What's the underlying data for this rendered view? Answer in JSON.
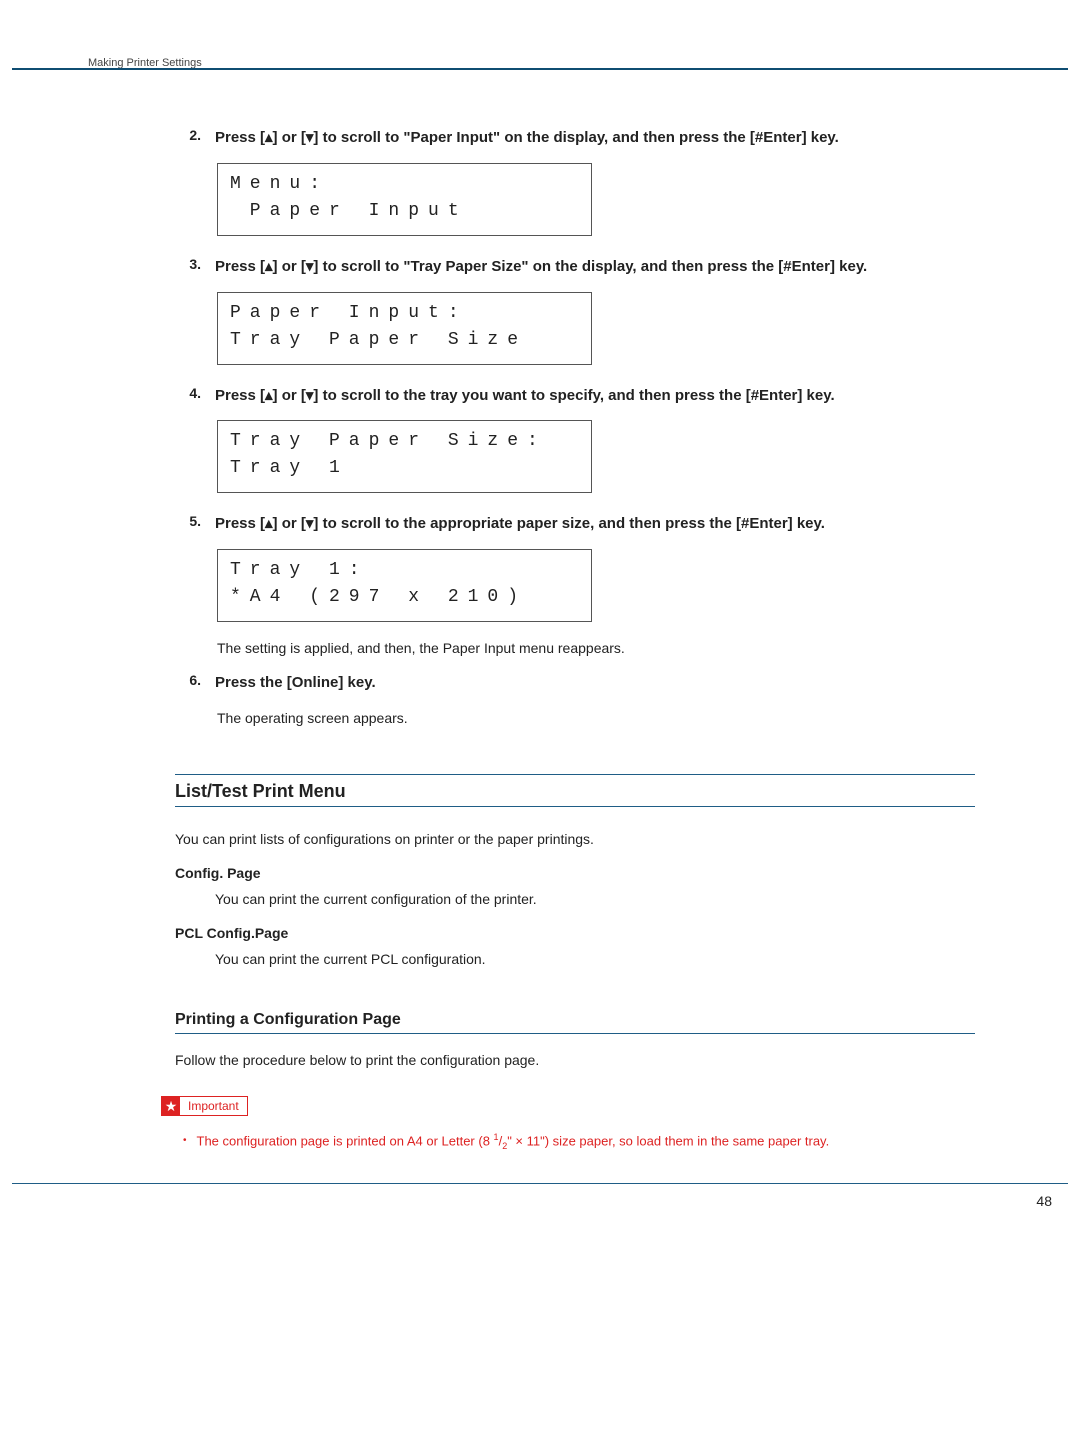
{
  "header": {
    "running_head": "Making Printer Settings"
  },
  "steps": [
    {
      "num": "2",
      "text": "Press [▴] or [▾] to scroll to \"Paper Input\" on the display, and then press the [#Enter] key.",
      "lcd": [
        "Menu:",
        " Paper Input"
      ]
    },
    {
      "num": "3",
      "text": "Press [▴] or [▾] to scroll to \"Tray Paper Size\" on the display, and then press the [#Enter] key.",
      "lcd": [
        "Paper Input:",
        "Tray Paper Size"
      ]
    },
    {
      "num": "4",
      "text": "Press [▴] or [▾] to scroll to the tray you want to specify, and then press the [#Enter] key.",
      "lcd": [
        "Tray Paper Size:",
        "Tray 1"
      ]
    },
    {
      "num": "5",
      "text": "Press [▴] or [▾] to scroll to the appropriate paper size, and then press the [#Enter] key.",
      "lcd": [
        "Tray 1:",
        "*A4 (297 x 210)"
      ],
      "after_note": "The setting is applied, and then, the Paper Input menu reappears."
    },
    {
      "num": "6",
      "text": "Press the [Online] key.",
      "after_note": "The operating screen appears."
    }
  ],
  "section": {
    "heading": "List/Test Print Menu",
    "intro": "You can print lists of configurations on printer or the paper printings.",
    "items": [
      {
        "term": "Config. Page",
        "desc": "You can print the current configuration of the printer."
      },
      {
        "term": "PCL Config.Page",
        "desc": "You can print the current PCL configuration."
      }
    ],
    "subhead": "Printing a Configuration Page",
    "sub_intro": "Follow the procedure below to print the configuration page.",
    "important_label": "Important",
    "important_bullet_pre": "The configuration page is printed on A4 or Letter (8 ",
    "important_bullet_frac_num": "1",
    "important_bullet_frac_den": "2",
    "important_bullet_post": "\" × 11\") size paper, so load them in the same paper tray."
  },
  "page_number": "48"
}
